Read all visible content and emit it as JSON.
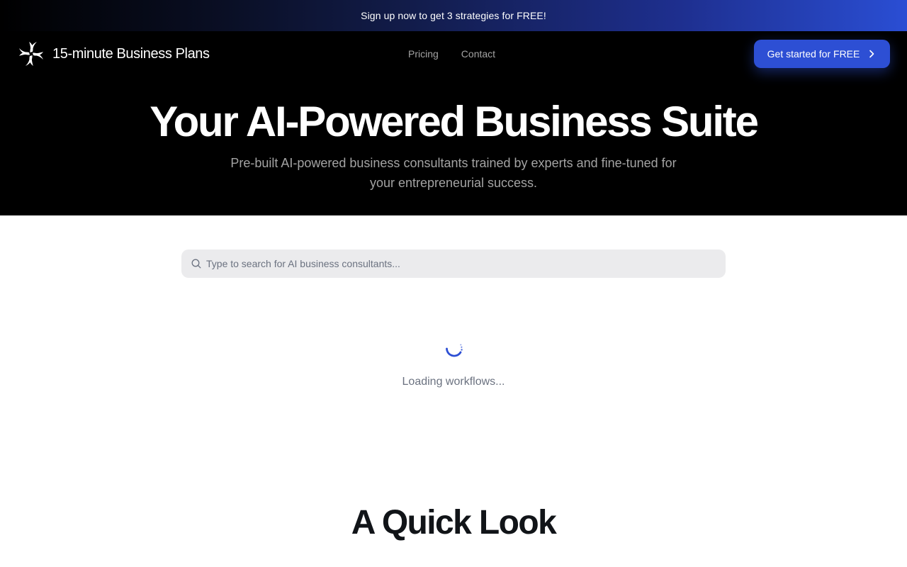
{
  "promo": {
    "text": "Sign up now to get 3 strategies for FREE!"
  },
  "header": {
    "logo_text": "15-minute Business Plans",
    "logo_icon": "swirl-logo-icon",
    "nav": [
      {
        "label": "Pricing"
      },
      {
        "label": "Contact"
      }
    ],
    "cta": {
      "label": "Get started for FREE",
      "icon": "chevron-right-icon"
    }
  },
  "hero": {
    "title": "Your AI-Powered Business Suite",
    "subtitle": "Pre-built AI-powered business consultants trained by experts and fine-tuned for your entrepreneurial success."
  },
  "search": {
    "placeholder": "Type to search for AI business consultants...",
    "value": "",
    "icon": "search-icon"
  },
  "loading": {
    "text": "Loading workflows...",
    "icon": "spinner-icon"
  },
  "section": {
    "title": "A Quick Look"
  },
  "colors": {
    "accent": "#2d4fd4",
    "hero_background": "#000000",
    "promo_gradient_start": "#000000",
    "promo_gradient_end": "#2a4ed4"
  }
}
